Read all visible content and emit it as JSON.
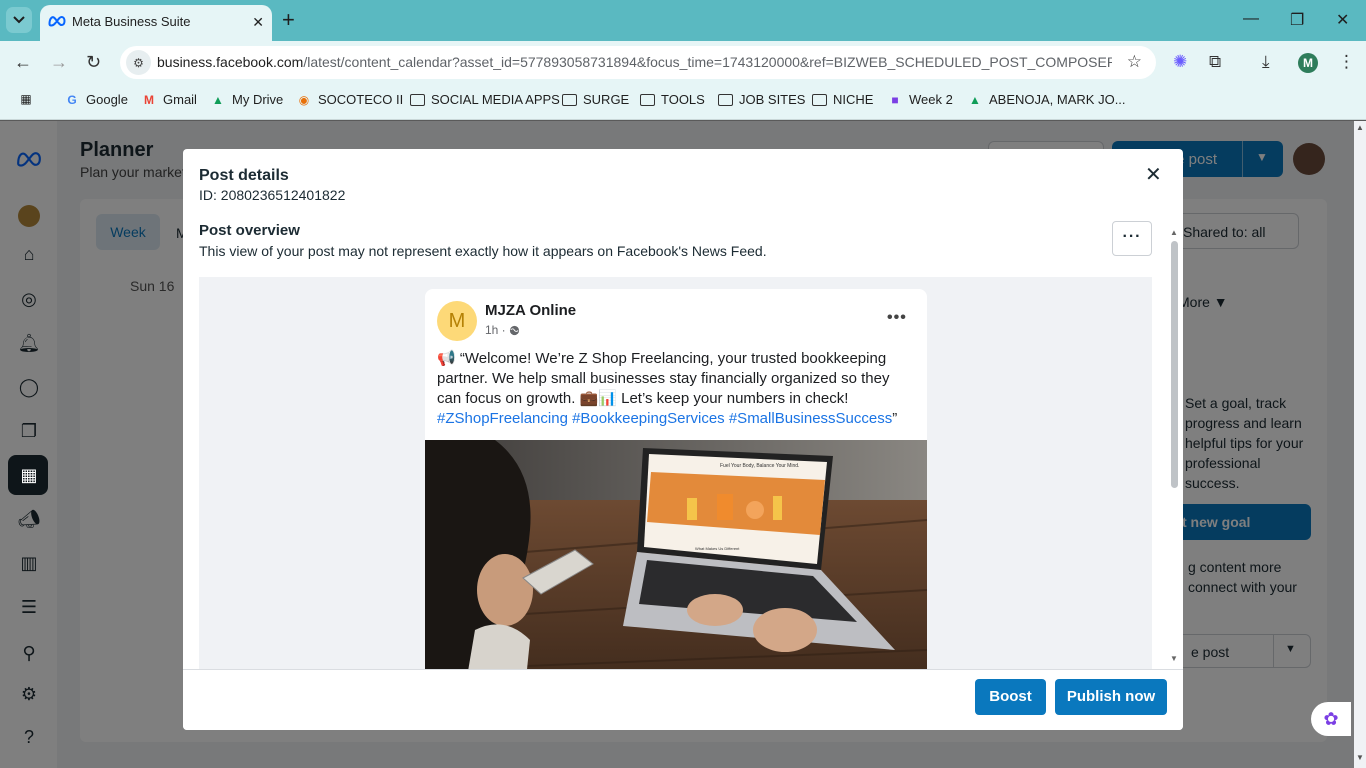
{
  "browser": {
    "tab_title": "Meta Business Suite",
    "url_host": "business.facebook.com",
    "url_path": "/latest/content_calendar?asset_id=577893058731894&focus_time=1743120000&ref=BIZWEB_SCHEDULED_POST_COMPOSER&na...",
    "profile_initial": "M",
    "bookmarks": [
      "Google",
      "Gmail",
      "My Drive",
      "SOCOTECO II",
      "SOCIAL MEDIA APPS",
      "SURGE",
      "TOOLS",
      "JOB SITES",
      "NICHE",
      "Week 2",
      "ABENOJA, MARK JO..."
    ]
  },
  "app": {
    "title": "Planner",
    "subtitle": "Plan your market",
    "create_post": "te post",
    "view_week": "Week",
    "view_month_cut": "M",
    "day_label": "Sun 16",
    "shared_filter": "Shared to: all",
    "more": "More",
    "goal_text": "Set a goal, track progress and learn helpful tips for your professional success.",
    "goal_button": "t new goal",
    "content_text": "g content more connect with your",
    "post_button": "e post"
  },
  "modal": {
    "title": "Post details",
    "id_text": "ID: 2080236512401822",
    "overview_title": "Post overview",
    "overview_subtitle": "This view of your post may not represent exactly how it appears on Facebook's News Feed.",
    "boost": "Boost",
    "publish": "Publish now"
  },
  "post": {
    "avatar_letter": "M",
    "page_name": "MJZA Online",
    "time": "1h ·",
    "body": "📢 “Welcome! We’re Z Shop Freelancing, your trusted bookkeeping partner. We help small businesses stay financially organized so they can focus on growth. 💼📊 Let’s keep your numbers in check!",
    "hashtags": "#ZShopFreelancing #BookkeepingServices #SmallBusinessSuccess",
    "closing_quote": "”",
    "image_site_heading": "Fuel Your Body, Balance Your Mind.",
    "image_site_footer": "What Makes Us Different"
  },
  "colors": {
    "chrome": "#5ab9c1",
    "chrome_light": "#e6f5f6",
    "primary": "#0a78be",
    "hashtag": "#1b74e4"
  }
}
